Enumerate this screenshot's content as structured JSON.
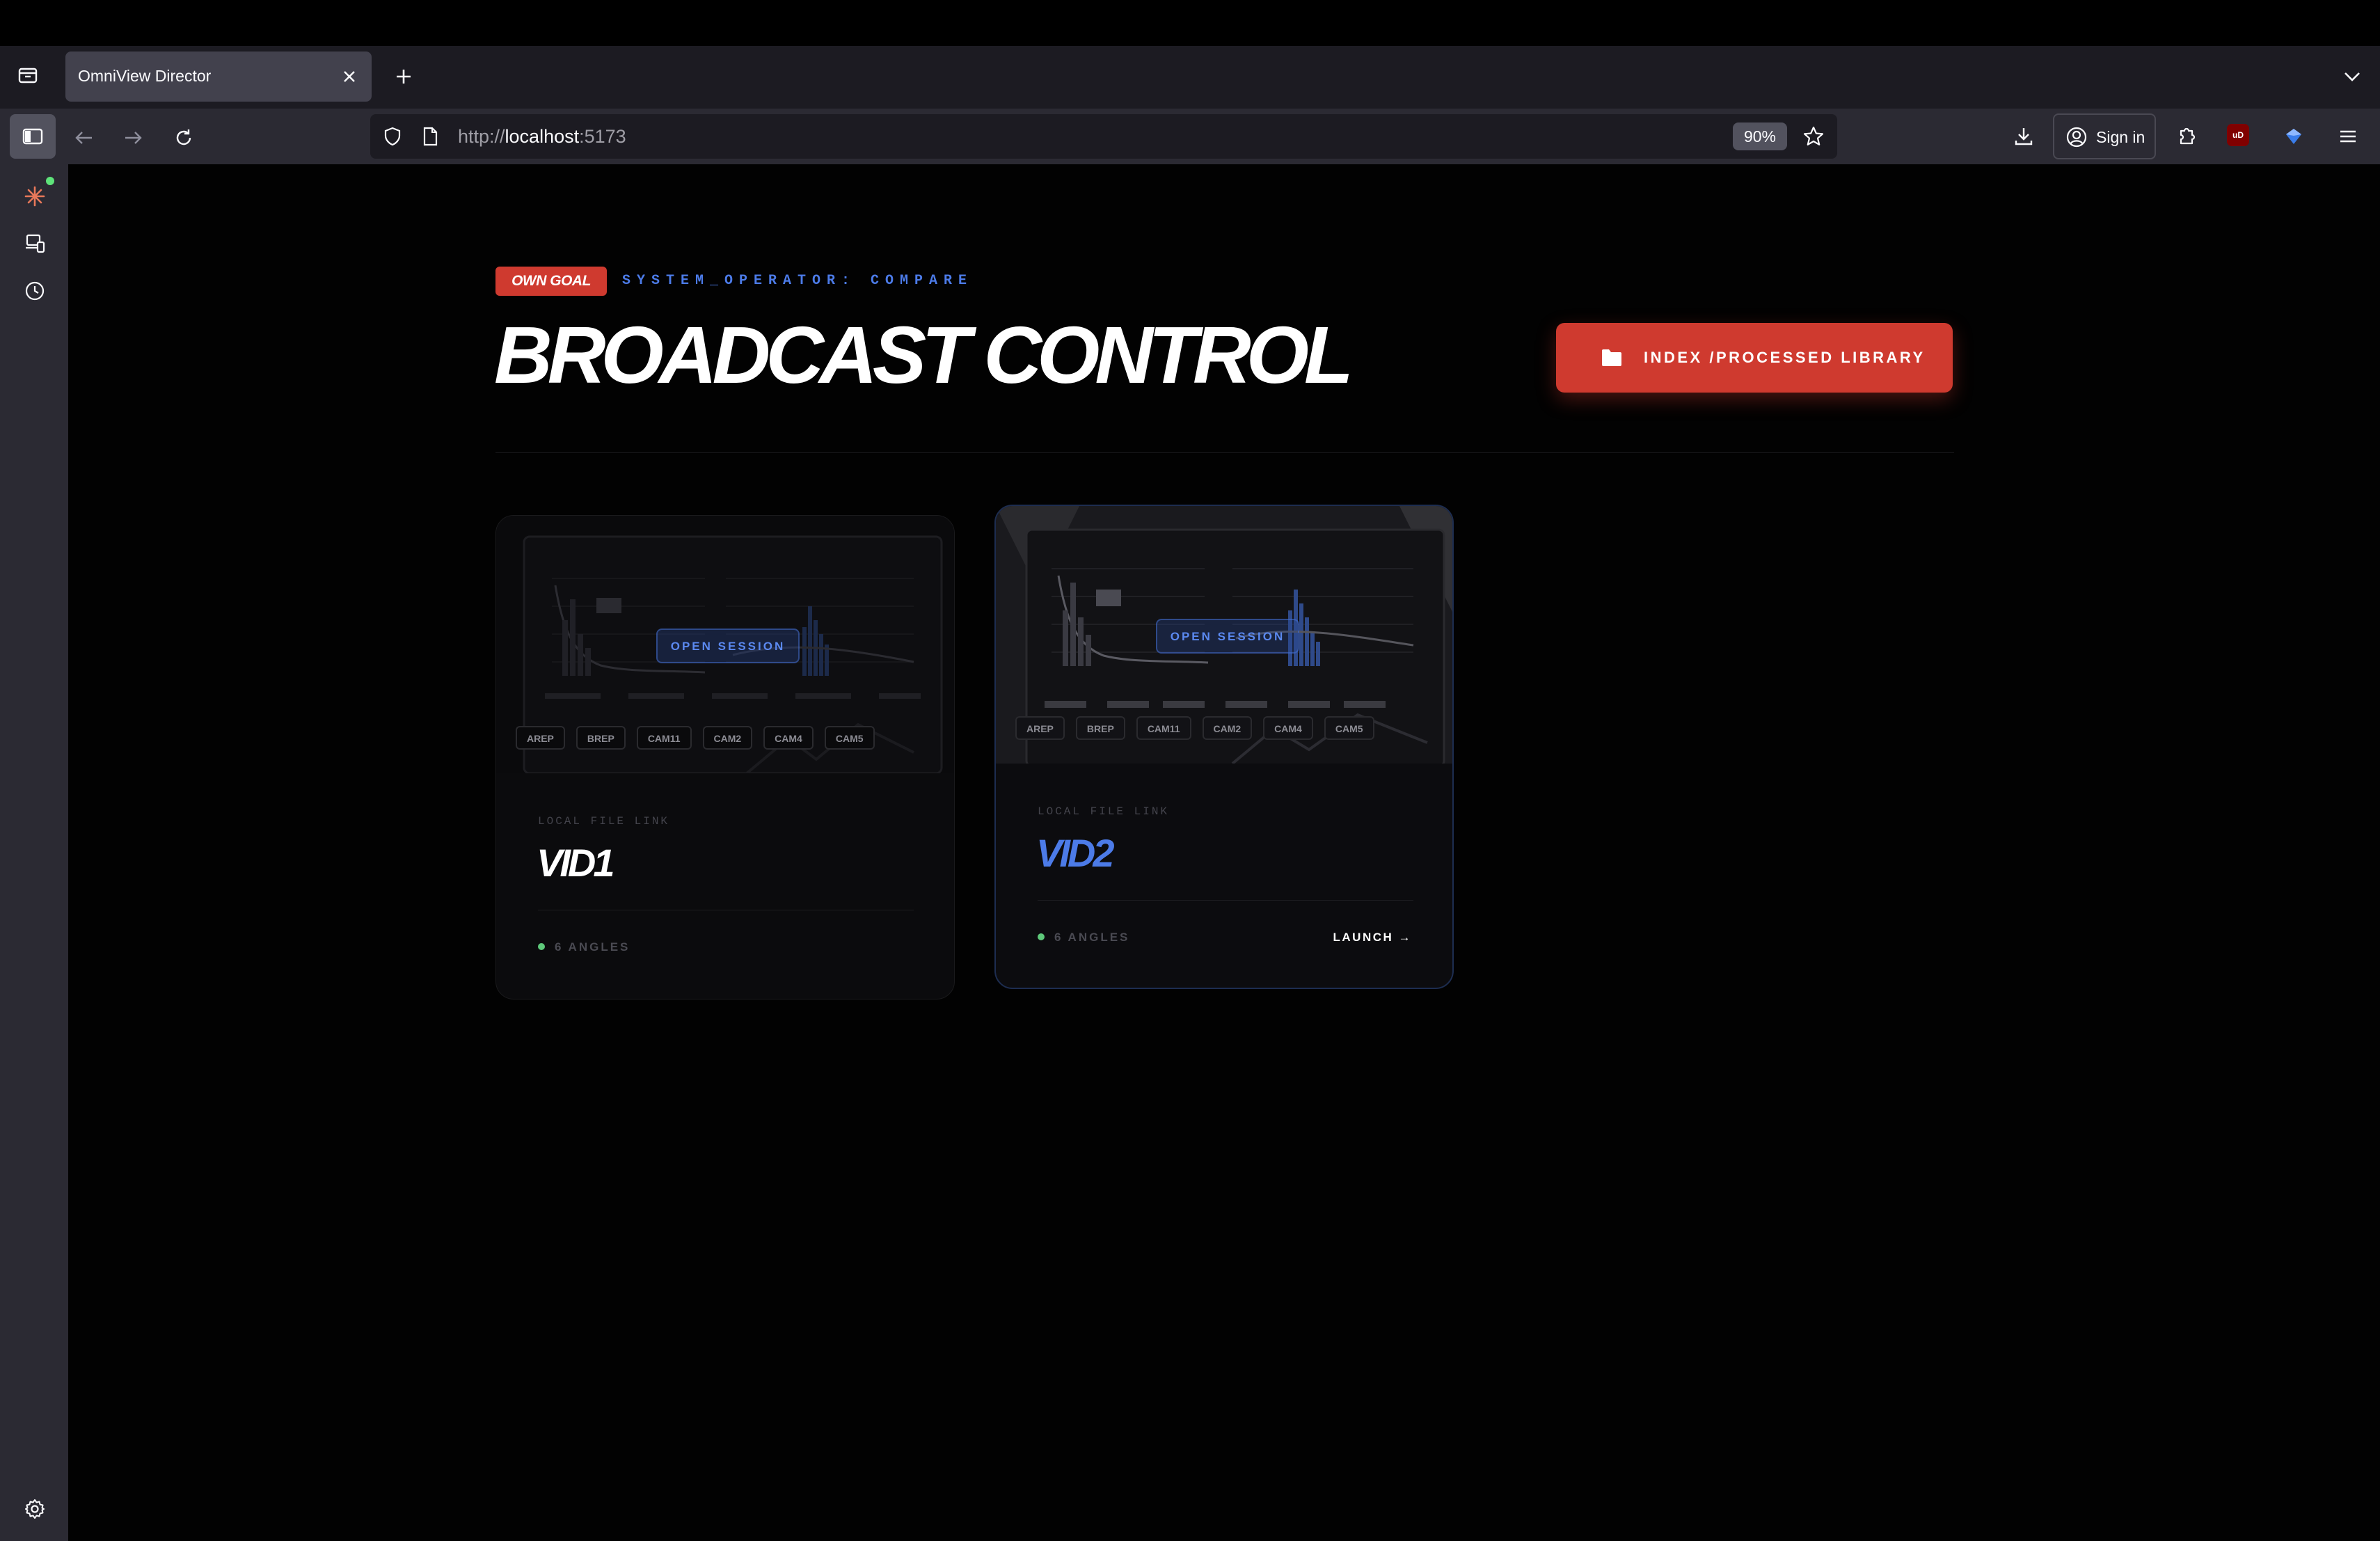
{
  "browser": {
    "tab_title": "OmniView Director",
    "url_scheme": "http://",
    "url_host": "localhost",
    "url_port": ":5173",
    "zoom": "90%",
    "signin_label": "Sign in",
    "ublock_badge": "uD"
  },
  "header": {
    "badge": "OWN GOAL",
    "system_label": "SYSTEM_OPERATOR: COMPARE",
    "title": "BROADCAST CONTROL",
    "library_button": "INDEX /PROCESSED LIBRARY"
  },
  "sessions": [
    {
      "open_label": "OPEN SESSION",
      "cams": [
        "AREP",
        "BREP",
        "CAM11",
        "CAM2",
        "CAM4",
        "CAM5"
      ],
      "kicker": "LOCAL FILE LINK",
      "name": "VID1",
      "angles": "6 ANGLES"
    },
    {
      "open_label": "OPEN SESSION",
      "cams": [
        "AREP",
        "BREP",
        "CAM11",
        "CAM2",
        "CAM4",
        "CAM5"
      ],
      "kicker": "LOCAL FILE LINK",
      "name": "VID2",
      "angles": "6 ANGLES",
      "launch": "LAUNCH →"
    }
  ],
  "colors": {
    "accent_red": "#cf3a2f",
    "accent_blue": "#4c7be8",
    "status_green": "#5ec97a",
    "background": "#020202"
  }
}
